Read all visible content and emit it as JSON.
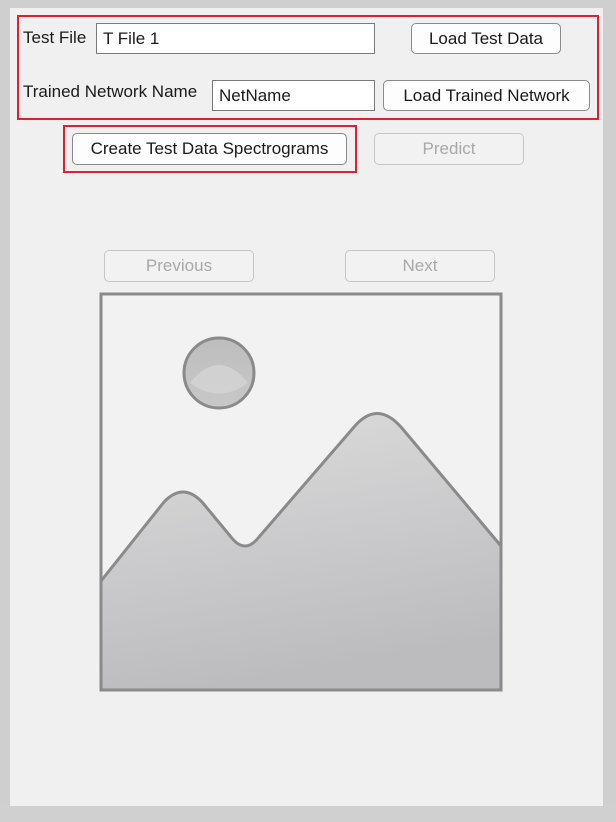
{
  "test_file": {
    "label": "Test File",
    "value": "T File 1",
    "load_button": "Load Test Data"
  },
  "network": {
    "label": "Trained Network Name",
    "value": "NetName",
    "load_button": "Load Trained Network"
  },
  "actions": {
    "create_spectrograms": "Create Test Data Spectrograms",
    "predict": "Predict"
  },
  "navigation": {
    "previous": "Previous",
    "next": "Next"
  },
  "image": {
    "icon": "image-placeholder-icon"
  },
  "colors": {
    "highlight_border": "#e0202c",
    "panel_background": "#f0f0f0",
    "disabled_text": "#a8a8a8"
  }
}
